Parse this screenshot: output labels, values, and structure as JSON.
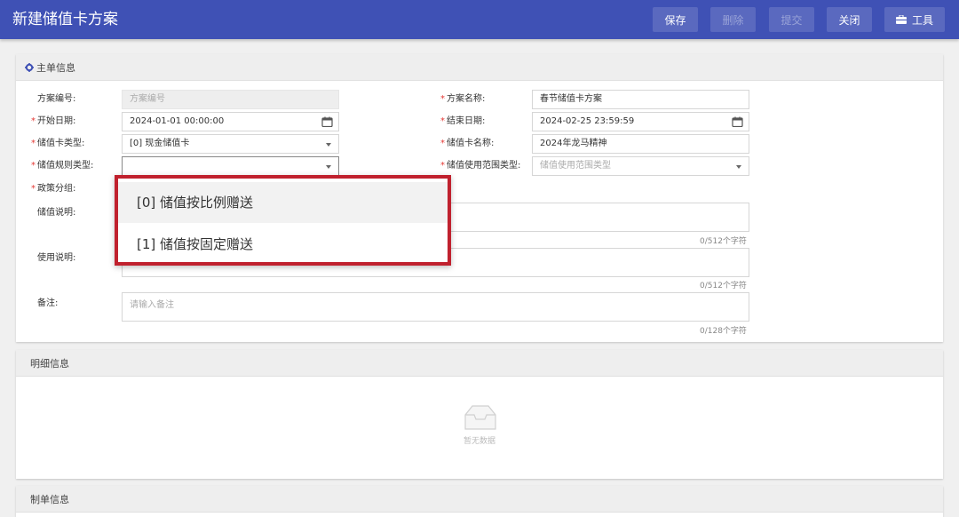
{
  "header": {
    "title": "新建储值卡方案",
    "buttons": {
      "save": "保存",
      "delete": "删除",
      "submit": "提交",
      "close": "关闭",
      "tools": "工具"
    }
  },
  "main_info": {
    "title": "主单信息",
    "fields": {
      "plan_code": {
        "label": "方案编号:",
        "placeholder": "方案编号"
      },
      "plan_name": {
        "label": "方案名称:",
        "value": "春节储值卡方案"
      },
      "start_date": {
        "label": "开始日期:",
        "value": "2024-01-01 00:00:00"
      },
      "end_date": {
        "label": "结束日期:",
        "value": "2024-02-25 23:59:59"
      },
      "card_type": {
        "label": "储值卡类型:",
        "value": "[0] 现金储值卡"
      },
      "card_name": {
        "label": "储值卡名称:",
        "value": "2024年龙马精神"
      },
      "rule_type": {
        "label": "储值规则类型:",
        "value": ""
      },
      "scope_type": {
        "label": "储值使用范围类型:",
        "placeholder": "储值使用范围类型"
      },
      "policy_group": {
        "label": "政策分组:"
      },
      "store_desc": {
        "label": "储值说明:",
        "counter": "0/512个字符"
      },
      "use_desc": {
        "label": "使用说明:",
        "counter": "0/512个字符"
      },
      "remark": {
        "label": "备注:",
        "placeholder": "请输入备注",
        "counter": "0/128个字符"
      }
    },
    "rule_type_options": [
      "[0] 储值按比例赠送",
      "[1] 储值按固定赠送"
    ]
  },
  "detail_info": {
    "title": "明细信息",
    "empty_text": "暂无数据"
  },
  "doc_info": {
    "title": "制单信息"
  },
  "colors": {
    "primary": "#3f51b5",
    "required": "#e53935",
    "highlight": "#c0212e"
  }
}
